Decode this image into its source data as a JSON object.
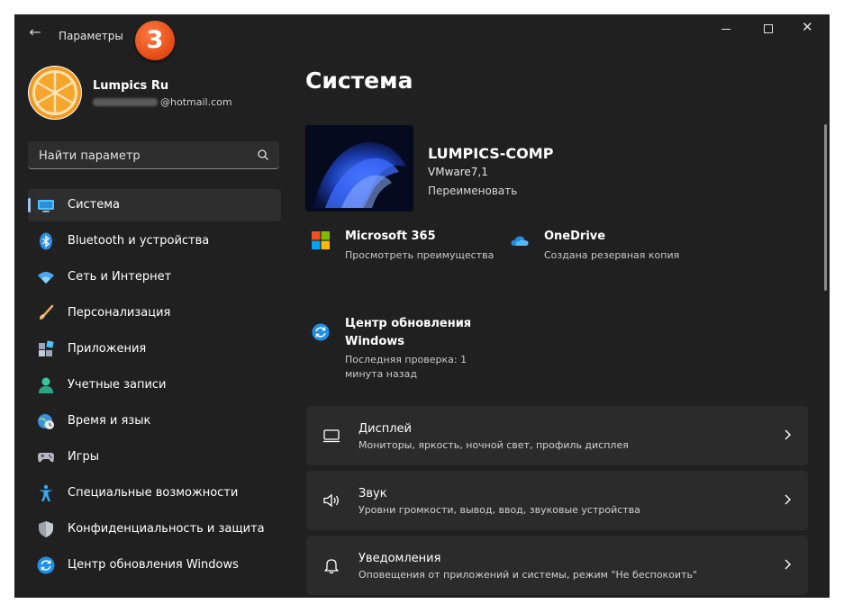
{
  "window": {
    "title": "Параметры",
    "step_badge": "3"
  },
  "user": {
    "name": "Lumpics Ru",
    "email_suffix": "@hotmail.com"
  },
  "search": {
    "placeholder": "Найти параметр"
  },
  "sidebar": {
    "items": [
      {
        "label": "Система",
        "icon": "system-icon",
        "active": true
      },
      {
        "label": "Bluetooth и устройства",
        "icon": "bluetooth-icon"
      },
      {
        "label": "Сеть и Интернет",
        "icon": "wifi-icon"
      },
      {
        "label": "Персонализация",
        "icon": "brush-icon"
      },
      {
        "label": "Приложения",
        "icon": "apps-icon"
      },
      {
        "label": "Учетные записи",
        "icon": "person-icon"
      },
      {
        "label": "Время и язык",
        "icon": "globe-clock-icon"
      },
      {
        "label": "Игры",
        "icon": "gamepad-icon"
      },
      {
        "label": "Специальные возможности",
        "icon": "accessibility-icon"
      },
      {
        "label": "Конфиденциальность и защита",
        "icon": "shield-icon"
      },
      {
        "label": "Центр обновления Windows",
        "icon": "update-icon"
      }
    ]
  },
  "main": {
    "title": "Система",
    "device": {
      "name": "LUMPICS-COMP",
      "model": "VMware7,1",
      "rename": "Переименовать"
    },
    "microsoft365": {
      "title": "Microsoft 365",
      "subtitle": "Просмотреть преимущества"
    },
    "onedrive": {
      "title": "OneDrive",
      "subtitle": "Создана резервная копия"
    },
    "update": {
      "title": "Центр обновления Windows",
      "subtitle": "Последняя проверка: 1 минута назад"
    },
    "settings": [
      {
        "title": "Дисплей",
        "subtitle": "Мониторы, яркость, ночной свет, профиль дисплея",
        "icon": "display-icon"
      },
      {
        "title": "Звук",
        "subtitle": "Уровни громкости, вывод, ввод, звуковые устройства",
        "icon": "speaker-icon"
      },
      {
        "title": "Уведомления",
        "subtitle": "Оповещения от приложений и системы, режим \"Не беспокоить\"",
        "icon": "bell-icon"
      }
    ]
  },
  "colors": {
    "window_bg": "#202020",
    "card_bg": "#2b2b2b",
    "accent": "#4cc2ff",
    "badge": "#e34a12"
  }
}
